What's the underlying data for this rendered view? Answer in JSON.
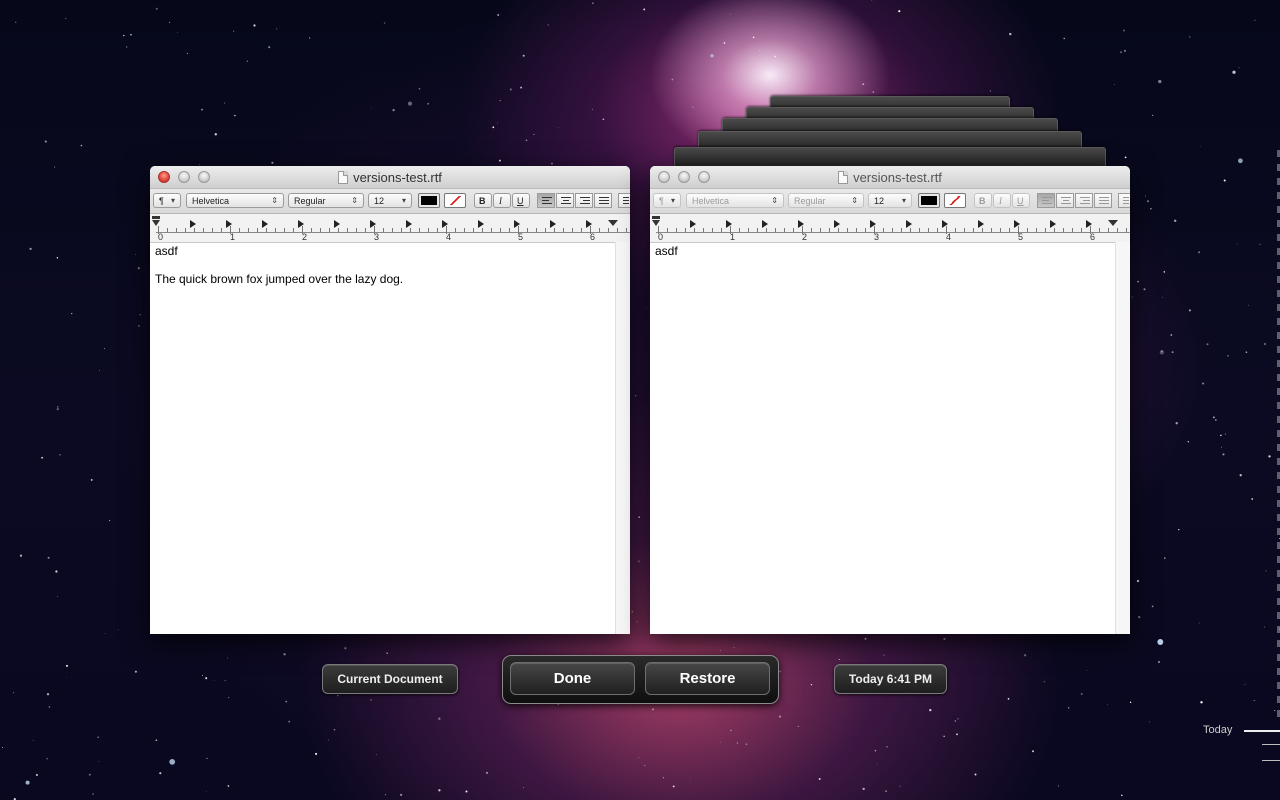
{
  "background": {
    "name": "galaxy-wallpaper"
  },
  "window_left": {
    "title": "versions-test.rtf",
    "toolbar": {
      "paragraph_label": "¶",
      "font_family": "Helvetica",
      "font_style": "Regular",
      "font_size": "12",
      "bold_label": "B",
      "italic_label": "I",
      "underline_label": "U"
    },
    "ruler_numbers": [
      "0",
      "1",
      "2",
      "3",
      "4",
      "5",
      "6"
    ],
    "content": {
      "line1": "asdf",
      "line2": "The quick brown fox jumped over the lazy dog."
    }
  },
  "window_right": {
    "title": "versions-test.rtf",
    "toolbar": {
      "paragraph_label": "¶",
      "font_family": "Helvetica",
      "font_style": "Regular",
      "font_size": "12",
      "bold_label": "B",
      "italic_label": "I",
      "underline_label": "U"
    },
    "ruler_numbers": [
      "0",
      "1",
      "2",
      "3",
      "4",
      "5",
      "6"
    ],
    "content": {
      "line1": "asdf"
    }
  },
  "controls": {
    "current_document_label": "Current Document",
    "done_label": "Done",
    "restore_label": "Restore",
    "version_timestamp": "Today 6:41 PM"
  },
  "timeline": {
    "today_label": "Today"
  },
  "colors": {
    "text_color_swatch": "#000000",
    "close_button": "#e0443a"
  }
}
